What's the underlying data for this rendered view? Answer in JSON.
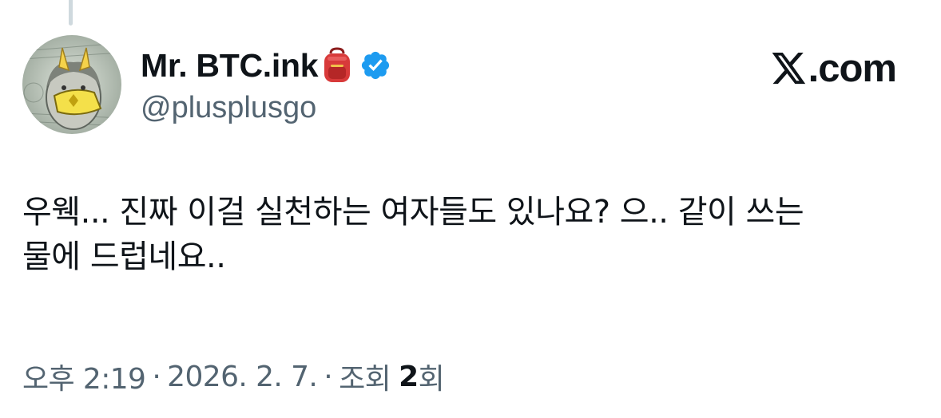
{
  "author": {
    "display_name": "Mr. BTC.ink",
    "handle": "@plusplusgo",
    "emoji_icon": "backpack-icon",
    "badge_icon": "verified-badge-icon",
    "badge_color": "#1d9bf0"
  },
  "brand": {
    "logo_icon": "x-logo-icon",
    "logo_text": ".com"
  },
  "tweet": {
    "lines": [
      "우웩... 진짜 이걸 실천하는 여자들도 있나요? 으.. 같이 쓰는",
      "물에 드럽네요.."
    ]
  },
  "meta": {
    "time": "오후 2:19",
    "separator": "·",
    "date": "2026. 2. 7.",
    "views_label": "조회",
    "views_count": "2",
    "views_suffix": "회"
  },
  "colors": {
    "text_primary": "#0f1419",
    "text_secondary": "#536471",
    "thread_line": "#cfd9de"
  }
}
